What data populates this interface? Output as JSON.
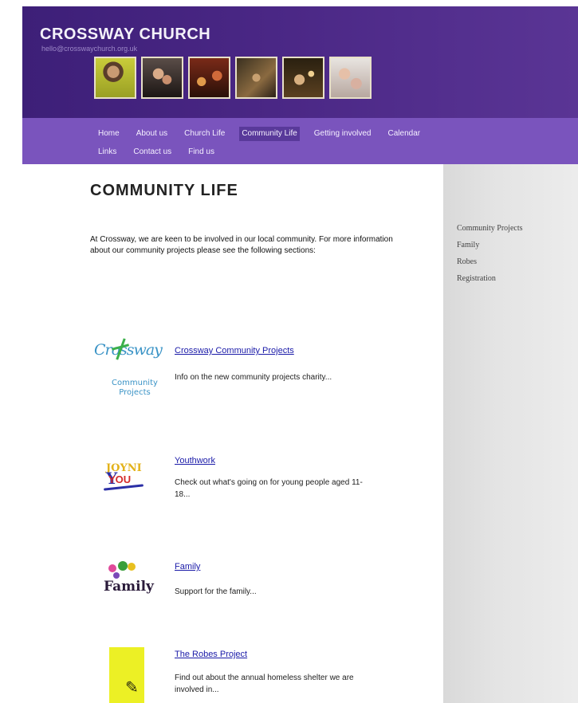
{
  "header": {
    "site_title": "CROSSWAY CHURCH",
    "email": "hello@crosswaychurch.org.uk",
    "photos": [
      "photo-1",
      "photo-2",
      "photo-3",
      "photo-4",
      "photo-5",
      "photo-6"
    ]
  },
  "nav": {
    "row1": [
      "Home",
      "About us",
      "Church Life",
      "Community Life",
      "Getting involved",
      "Calendar"
    ],
    "row2": [
      "Links",
      "Contact us",
      "Find us"
    ],
    "active": "Community Life"
  },
  "main": {
    "title": "COMMUNITY LIFE",
    "intro": "At Crossway, we are keen to be involved in our local community. For more information about our community projects please see the following sections:",
    "entries": [
      {
        "link": "Crossway Community Projects",
        "desc": "Info on the new community projects charity..."
      },
      {
        "link": "Youthwork",
        "desc": "Check out what's going on for young people aged 11-18..."
      },
      {
        "link": "Family",
        "desc": "Support for the family..."
      },
      {
        "link": "The Robes Project",
        "desc": "Find out about the annual homeless shelter we are involved in..."
      }
    ],
    "logos": {
      "crossway_top": "Crossway",
      "crossway_bottom": "Community Projects",
      "youth_gold": "JOYNI",
      "youth_red": "YOU",
      "family": "Family"
    }
  },
  "sidebar": {
    "links": [
      "Community Projects",
      "Family",
      "Robes",
      "Registration"
    ]
  },
  "colors": {
    "header_bg": "#3d1f78",
    "nav_bg": "#7a54bd",
    "nav_active": "#59399a",
    "link": "#1a1aa8",
    "sidebar_bg": "#e4e4e4"
  }
}
